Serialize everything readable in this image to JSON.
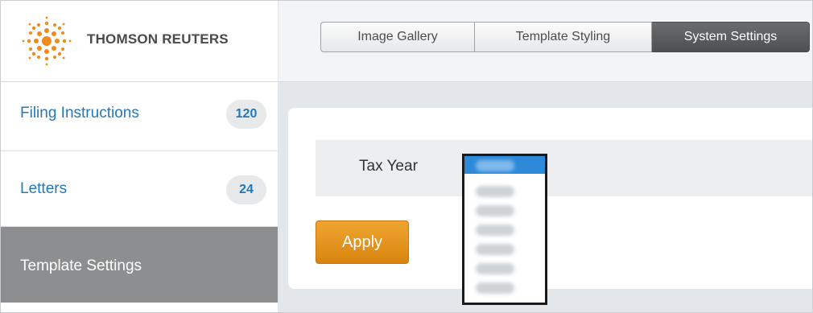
{
  "app": {
    "brand": "THOMSON REUTERS",
    "accent_color": "#2478b5",
    "action_color": "#e8951f"
  },
  "header": {
    "tabs": [
      {
        "label": "Image Gallery",
        "active": false
      },
      {
        "label": "Template Styling",
        "active": false
      },
      {
        "label": "System Settings",
        "active": true
      }
    ]
  },
  "sidebar": {
    "items": [
      {
        "label": "Filing Instructions",
        "count": "120",
        "active": false
      },
      {
        "label": "Letters",
        "count": "24",
        "active": false
      },
      {
        "label": "Template Settings",
        "active": true
      }
    ]
  },
  "form": {
    "tax_year_label": "Tax Year",
    "apply_label": "Apply",
    "tax_year_dropdown": {
      "open": true,
      "options_visible": 7,
      "selected_index": 0,
      "option_text_obscured": true
    }
  },
  "icons": {
    "logo": "thomson-reuters-logo"
  }
}
